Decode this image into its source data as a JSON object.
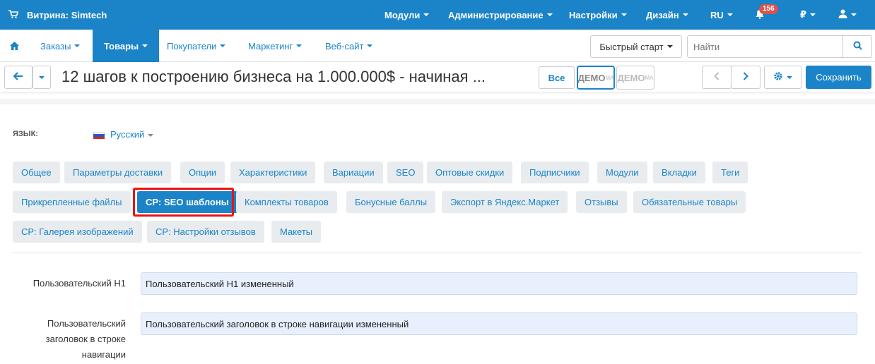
{
  "topbar": {
    "store": "Витрина: Simtech",
    "menu": [
      "Модули",
      "Администрирование",
      "Настройки",
      "Дизайн",
      "RU"
    ],
    "notifications_count": "156",
    "currency": "₽"
  },
  "nav": {
    "items": [
      "Заказы",
      "Товары",
      "Покупатели",
      "Маркетинг",
      "Веб-сайт"
    ],
    "quick_start": "Быстрый старт",
    "search_placeholder": "Найти"
  },
  "title_bar": {
    "title": "12 шагов к построению бизнеса на 1.000.000$ - начиная ...",
    "all_button": "Все",
    "demo_label": "ДЕМО",
    "demo_sup": "МА",
    "save": "Сохранить"
  },
  "language": {
    "label": "ЯЗЫК:",
    "value": "Русский"
  },
  "tabs": {
    "row1": [
      "Общее",
      "Параметры доставки",
      "Опции",
      "Характеристики",
      "Вариации",
      "SEO",
      "Оптовые скидки",
      "Подписчики",
      "Модули",
      "Вкладки",
      "Теги"
    ],
    "row2": [
      "Прикрепленные файлы",
      "CP: SEO шаблоны",
      "Комплекты товаров",
      "Бонусные баллы",
      "Экспорт в Яндекс.Маркет",
      "Отзывы",
      "Обязательные товары"
    ],
    "row3": [
      "CP: Галерея изображений",
      "CP: Настройки отзывов",
      "Макеты"
    ],
    "active": "CP: SEO шаблоны"
  },
  "fields": [
    {
      "label": "Пользовательский H1",
      "value": "Пользовательский H1 измененный"
    },
    {
      "label": "Пользовательский заголовок в строке навигации",
      "value": "Пользовательский заголовок в строке навигации измененный"
    }
  ],
  "colors": {
    "accent": "#1b84c8",
    "highlight": "#e11111"
  }
}
